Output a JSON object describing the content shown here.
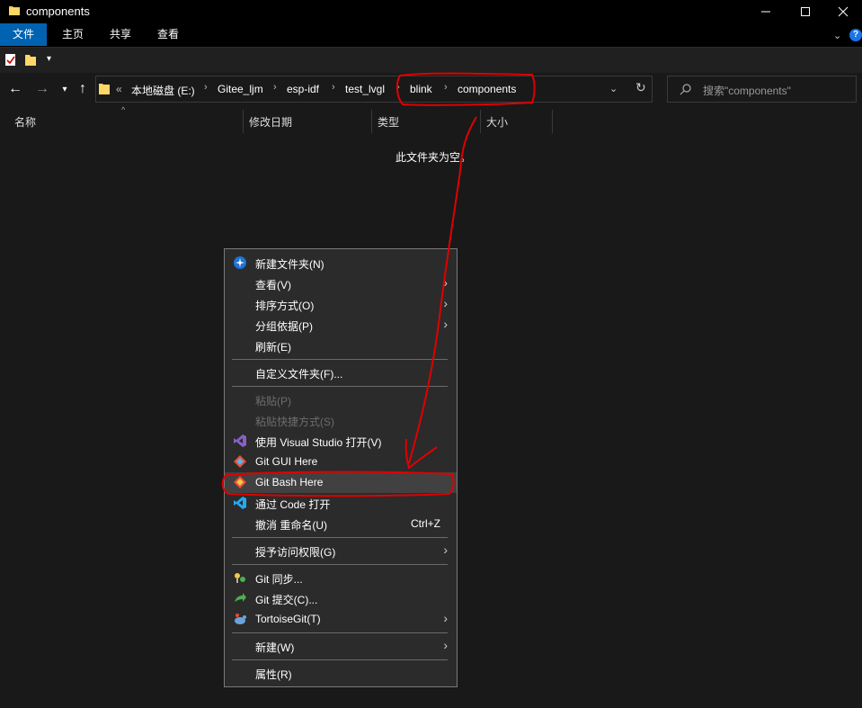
{
  "window": {
    "title": "components",
    "minimize_icon": "minimize-icon",
    "maximize_icon": "maximize-icon",
    "close_icon": "close-icon"
  },
  "ribbon": {
    "tabs": [
      "文件",
      "主页",
      "共享",
      "查看"
    ],
    "help_icon": "help-icon"
  },
  "address": {
    "prefix": "«",
    "crumbs": [
      "本地磁盘 (E:)",
      "Gitee_ljm",
      "esp-idf",
      "test_lvgl",
      "blink",
      "components"
    ]
  },
  "search": {
    "placeholder": "搜索\"components\""
  },
  "columns": [
    "名称",
    "修改日期",
    "类型",
    "大小"
  ],
  "empty_message": "此文件夹为空。",
  "context_menu": {
    "items": [
      {
        "label": "新建文件夹(N)",
        "icon": "new-folder-icon"
      },
      {
        "label": "查看(V)",
        "submenu": true
      },
      {
        "label": "排序方式(O)",
        "submenu": true
      },
      {
        "label": "分组依据(P)",
        "submenu": true
      },
      {
        "label": "刷新(E)"
      },
      {
        "label": "自定义文件夹(F)..."
      },
      {
        "label": "粘贴(P)",
        "disabled": true
      },
      {
        "label": "粘贴快捷方式(S)",
        "disabled": true
      },
      {
        "label": "使用 Visual Studio 打开(V)",
        "icon": "visual-studio-icon"
      },
      {
        "label": "Git GUI Here",
        "icon": "git-icon"
      },
      {
        "label": "Git Bash Here",
        "icon": "git-icon",
        "highlighted": true
      },
      {
        "label": "通过 Code 打开",
        "icon": "vscode-icon"
      },
      {
        "label": "撤消 重命名(U)",
        "shortcut": "Ctrl+Z"
      },
      {
        "label": "授予访问权限(G)",
        "submenu": true
      },
      {
        "label": "Git 同步...",
        "icon": "git-sync-icon"
      },
      {
        "label": "Git 提交(C)...",
        "icon": "git-commit-icon"
      },
      {
        "label": "TortoiseGit(T)",
        "icon": "tortoisegit-icon",
        "submenu": true
      },
      {
        "label": "新建(W)",
        "submenu": true
      },
      {
        "label": "属性(R)"
      }
    ]
  },
  "colors": {
    "accent": "#0063b1",
    "annotation_red": "#e00000",
    "background": "#191919",
    "menu_bg": "#2b2b2b"
  }
}
